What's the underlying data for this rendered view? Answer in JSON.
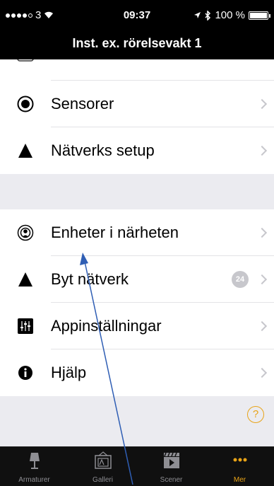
{
  "status_bar": {
    "carrier": "3",
    "time": "09:37",
    "battery": "100 %"
  },
  "nav_bar": {
    "title": "Inst. ex. rörelsevakt 1"
  },
  "menu": {
    "sensorer": "Sensorer",
    "natverks_setup": "Nätverks setup",
    "enheter": "Enheter i närheten",
    "byt_natverk": "Byt nätverk",
    "byt_natverk_badge": "24",
    "appinstallningar": "Appinställningar",
    "hjalp": "Hjälp",
    "help_symbol": "?"
  },
  "tabs": {
    "armaturer": "Armaturer",
    "galleri": "Galleri",
    "scener": "Scener",
    "mer": "Mer"
  },
  "colors": {
    "accent": "#e8a317",
    "arrow": "#2f5eb4"
  }
}
